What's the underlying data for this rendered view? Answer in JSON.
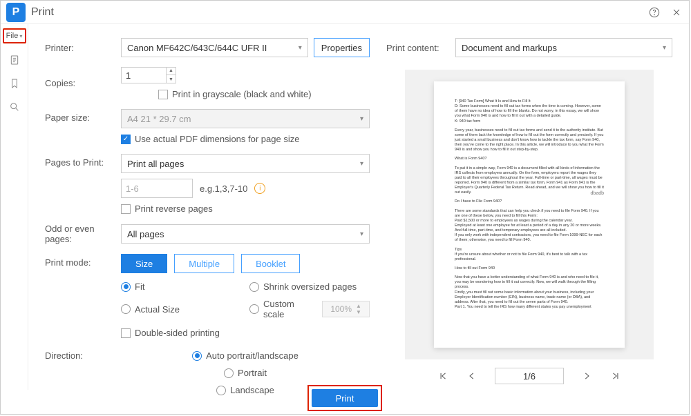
{
  "header": {
    "title": "Print"
  },
  "sidebar": {
    "file_label": "File"
  },
  "form": {
    "printer_label": "Printer:",
    "printer_value": "Canon MF642C/643C/644C UFR II",
    "properties_btn": "Properties",
    "copies_label": "Copies:",
    "copies_value": "1",
    "grayscale_label": "Print in grayscale (black and white)",
    "paper_label": "Paper size:",
    "paper_value": "A4 21 * 29.7 cm",
    "use_actual_label": "Use actual PDF dimensions for page size",
    "pages_label": "Pages to Print:",
    "pages_value": "Print all pages",
    "range_placeholder": "1-6",
    "range_example": "e.g.1,3,7-10",
    "reverse_label": "Print reverse pages",
    "odd_even_label": "Odd or even pages:",
    "odd_even_value": "All pages",
    "mode_label": "Print mode:",
    "mode_size": "Size",
    "mode_multiple": "Multiple",
    "mode_booklet": "Booklet",
    "radio_fit": "Fit",
    "radio_shrink": "Shrink oversized pages",
    "radio_actual": "Actual Size",
    "radio_custom": "Custom scale",
    "custom_scale_value": "100%",
    "double_sided_label": "Double-sided printing",
    "direction_label": "Direction:",
    "dir_auto": "Auto portrait/landscape",
    "dir_portrait": "Portrait",
    "dir_landscape": "Landscape"
  },
  "preview": {
    "content_label": "Print content:",
    "content_value": "Document and markups",
    "page_indicator": "1/6",
    "doc": {
      "h1": "T: [940 Tax Form] What It Is and How to Fill It",
      "p1": "D: Some businesses need to fill out tax forms when the time is coming. However, some of them have no idea of how to fill the blanks. Do not worry, in this essay, we will show you what Form 940 is and how to fill it out with a detailed guide.",
      "p1b": "K: 940 tax form",
      "p2": "Every year, businesses need to fill out tax forms and send it to the authority institute. But some of them lack the knowledge of how to fill out the form correctly and precisely. If you just started a small business and don't know how to tackle the tax form, say Form 940, then you've come to the right place. In this article, we will introduce to you what the Form 940 is and show you how to fill it out step-by-step.",
      "h2": "What is Form 940?",
      "p3": "To put it in a simple way, Form 940 is a document filled with all kinds of information the IRS collects from employers annually. On the form, employers report the wages they paid to all their employees throughout the year. Full-time or part-time, all wages must be reported. Form 940 is different from a similar tax form, Form 941 as Form 941 is the Employer's Quarterly Federal Tax Return. Read ahead, and we will show you how to fill it out easily.",
      "wm": "dbadb",
      "h3": "Do I have to File Form 940?",
      "p4": "There are some standards that can help you check if you need to file Form 940. If you are one of these below, you need to fill this Form:",
      "p4a": "Paid $1,500 or more to employees as wages during the calendar year.",
      "p4b": "Employed at least one employee for at least a period of a day in any 20 or more weeks. And full-time, part-time, and temporary employees are all included.",
      "p4c": "If you only work with independent contractors, you need to file Form 1099-NEC for each of them; otherwise, you need to fill Form 940.",
      "h4": "Tips",
      "p5": "If you're unsure about whether or not to file Form 940, it's best to talk with a tax professional.",
      "h5": "How to fill out Form 940",
      "p6": "Now that you have a better understanding of what Form 940 is and who need to file it, you may be wondering how to fill it out correctly. Now, we will walk through the filling process.",
      "p7": "Firstly, you must fill out some basic information about your business, including your Employer Identification number (EIN), business name, trade name (or DBA), and address. After that, you need to fill out the seven parts of Form 940.",
      "p8": "Part 1. You need to tell the IRS how many different states you pay unemployment"
    }
  },
  "footer": {
    "print_btn": "Print"
  }
}
